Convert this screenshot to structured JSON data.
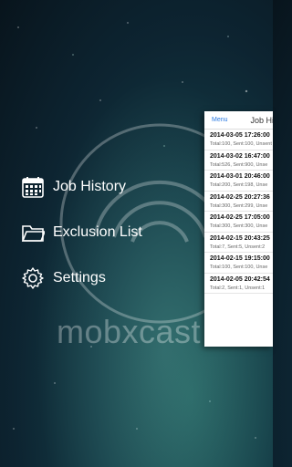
{
  "background": {
    "brand_accent": "#6fd3c7"
  },
  "watermark": "mobxcast",
  "drawer": {
    "items": [
      {
        "label": "Job History",
        "icon": "calendar-icon"
      },
      {
        "label": "Exclusion List",
        "icon": "folder-icon"
      },
      {
        "label": "Settings",
        "icon": "gear-icon"
      }
    ]
  },
  "panel": {
    "menu_label": "Menu",
    "title": "Job Hi",
    "rows": [
      {
        "datetime": "2014-03-05 17:26:00",
        "stats": "Total:100, Sent:100, Unsent"
      },
      {
        "datetime": "2014-03-02 16:47:00",
        "stats": "Total:526, Sent:900, Unse"
      },
      {
        "datetime": "2014-03-01 20:46:00",
        "stats": "Total:200, Sent:198, Unse"
      },
      {
        "datetime": "2014-02-25 20:27:36",
        "stats": "Total:300, Sent:299, Unse"
      },
      {
        "datetime": "2014-02-25 17:05:00",
        "stats": "Total:300, Sent:300, Unse"
      },
      {
        "datetime": "2014-02-15 20:43:25",
        "stats": "Total:7, Sent:5, Unsent:2"
      },
      {
        "datetime": "2014-02-15 19:15:00",
        "stats": "Total:100, Sent:100, Unse"
      },
      {
        "datetime": "2014-02-05 20:42:54",
        "stats": "Total:2, Sent:1, Unsent:1"
      }
    ]
  }
}
